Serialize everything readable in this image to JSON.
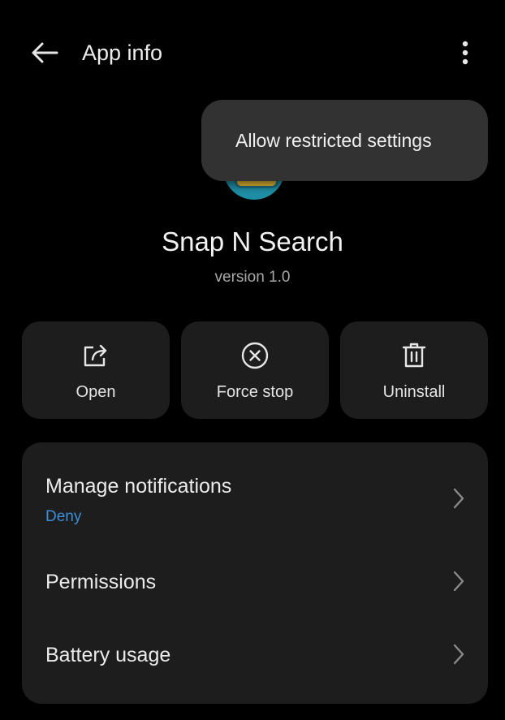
{
  "header": {
    "title": "App info",
    "back_icon": "arrow-left-icon",
    "more_icon": "more-vert-icon"
  },
  "popup": {
    "items": [
      "Allow restricted settings"
    ]
  },
  "app": {
    "name": "Snap N Search",
    "version": "version 1.0"
  },
  "actions": [
    {
      "label": "Open",
      "icon": "open-external-icon"
    },
    {
      "label": "Force stop",
      "icon": "stop-circle-icon"
    },
    {
      "label": "Uninstall",
      "icon": "trash-icon"
    }
  ],
  "settings": [
    {
      "title": "Manage notifications",
      "subtitle": "Deny"
    },
    {
      "title": "Permissions"
    },
    {
      "title": "Battery usage"
    }
  ],
  "colors": {
    "background": "#000000",
    "card": "#1d1d1d",
    "popup": "#323232",
    "accent_link": "#3d8ed8"
  }
}
